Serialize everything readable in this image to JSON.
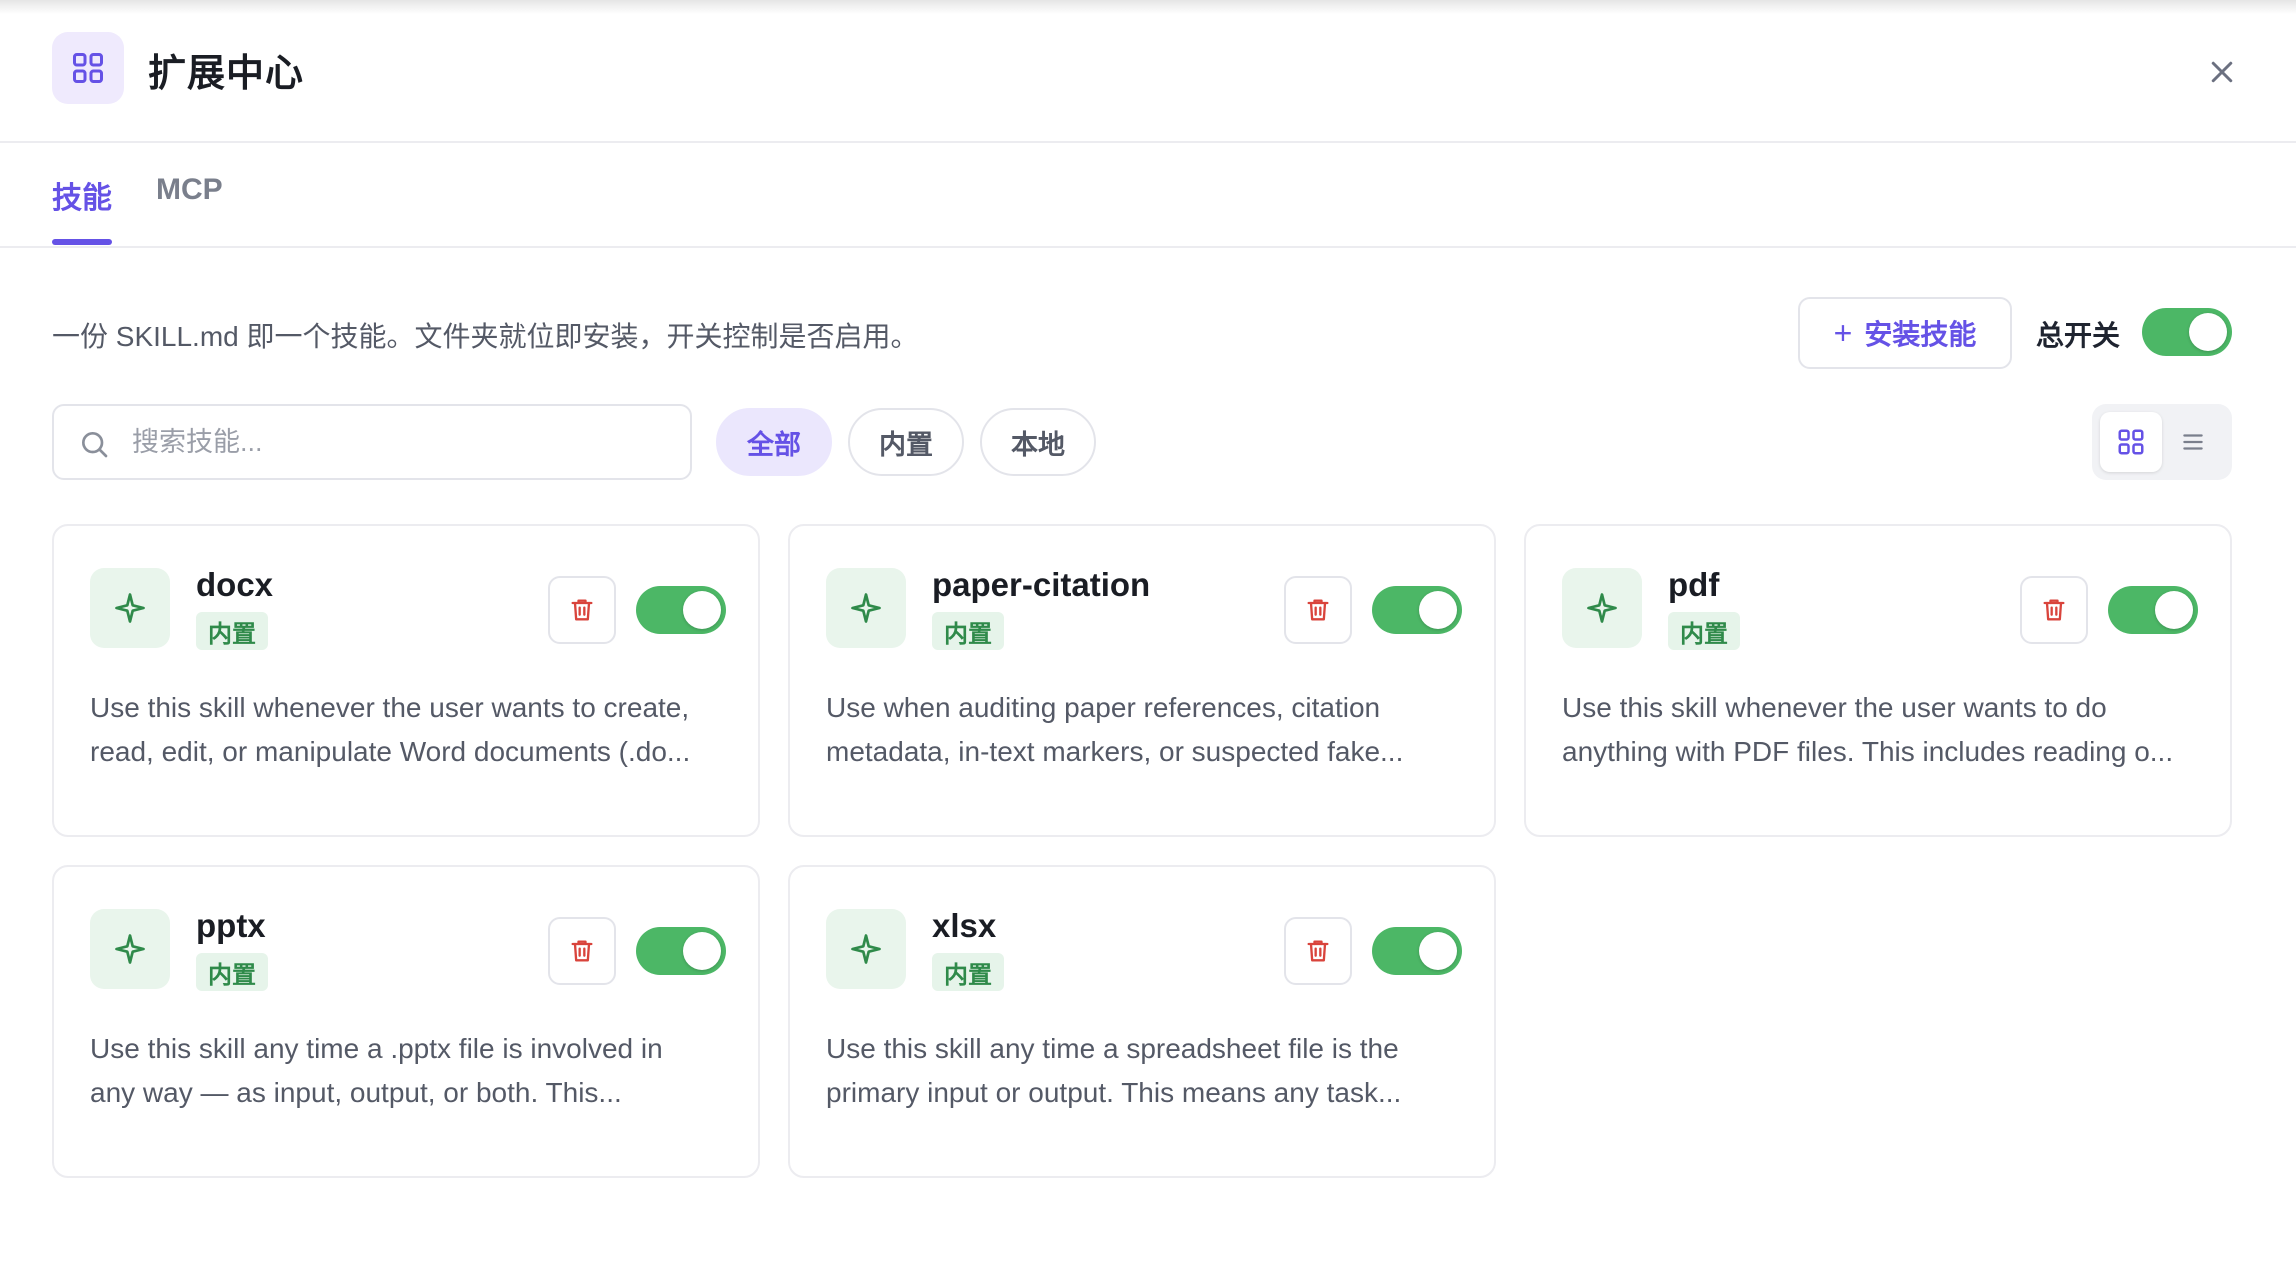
{
  "header": {
    "title": "扩展中心",
    "app_icon": "grid-icon",
    "close_icon": "close-icon"
  },
  "tabs": [
    {
      "label": "技能",
      "active": true
    },
    {
      "label": "MCP",
      "active": false
    }
  ],
  "description": "一份 SKILL.md 即一个技能。文件夹就位即安装，开关控制是否启用。",
  "install_button": {
    "label": "安装技能",
    "icon": "plus-icon"
  },
  "master_switch": {
    "label": "总开关",
    "on": true
  },
  "search": {
    "placeholder": "搜索技能...",
    "value": ""
  },
  "filters": [
    {
      "label": "全部",
      "active": true
    },
    {
      "label": "内置",
      "active": false
    },
    {
      "label": "本地",
      "active": false
    }
  ],
  "view_mode": {
    "options": [
      "grid-view-icon",
      "list-view-icon"
    ],
    "selected": "grid"
  },
  "skills": [
    {
      "name": "docx",
      "badge": "内置",
      "enabled": true,
      "desc_line1": "Use this skill whenever the user wants to create,",
      "desc_line2": "read, edit, or manipulate Word documents (.do..."
    },
    {
      "name": "paper-citation",
      "badge": "内置",
      "enabled": true,
      "desc_line1": "Use when auditing paper references, citation",
      "desc_line2": "metadata, in-text markers, or suspected fake..."
    },
    {
      "name": "pdf",
      "badge": "内置",
      "enabled": true,
      "desc_line1": "Use this skill whenever the user wants to do",
      "desc_line2": "anything with PDF files. This includes reading o..."
    },
    {
      "name": "pptx",
      "badge": "内置",
      "enabled": true,
      "desc_line1": "Use this skill any time a .pptx file is involved in",
      "desc_line2": "any way — as input, output, or both. This..."
    },
    {
      "name": "xlsx",
      "badge": "内置",
      "enabled": true,
      "desc_line1": "Use this skill any time a spreadsheet file is the",
      "desc_line2": "primary input or output. This means any task..."
    }
  ],
  "colors": {
    "accent": "#6552e6",
    "toggle_on": "#4cb766",
    "delete": "#d9443c",
    "skill_icon": "#2f8a4a"
  }
}
